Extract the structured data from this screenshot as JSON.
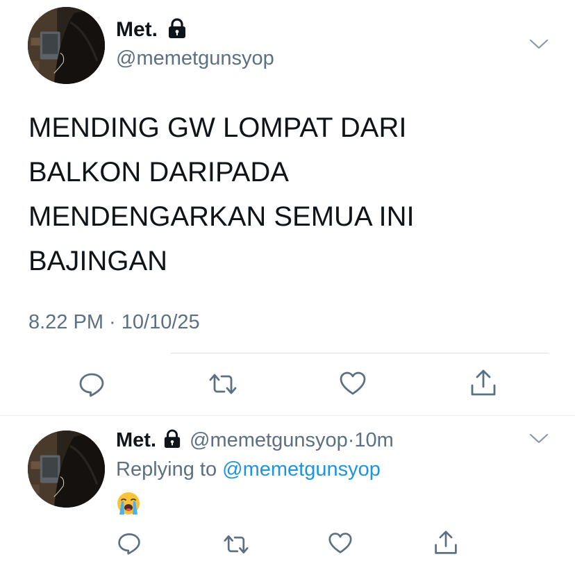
{
  "colors": {
    "text_primary": "#0f1419",
    "text_secondary": "#5b7083",
    "link": "#1b95e0",
    "icon": "#5b7083",
    "divider": "#e6ecf0"
  },
  "tweet": {
    "author_name": "Met.",
    "protected_icon": "lock-icon",
    "handle": "@memetgunsyop",
    "more_icon": "chevron-down-icon",
    "text_lines": [
      "MENDING GW LOMPAT DARI",
      "BALKON DARIPADA",
      "MENDENGARKAN SEMUA INI",
      "BAJINGAN"
    ],
    "timestamp": "8.22 PM · 10/10/25",
    "actions": [
      "reply-icon",
      "retweet-icon",
      "like-icon",
      "share-icon"
    ]
  },
  "reply": {
    "author_name": "Met.",
    "protected_icon": "lock-icon",
    "handle": "@memetgunsyop",
    "separator": "·",
    "time": "10m",
    "more_icon": "chevron-down-icon",
    "replying_prefix": "Replying to ",
    "replying_to": "@memetgunsyop",
    "content_emoji": "loudly-crying-face-emoji",
    "actions": [
      "reply-icon",
      "retweet-icon",
      "like-icon",
      "share-icon"
    ]
  }
}
